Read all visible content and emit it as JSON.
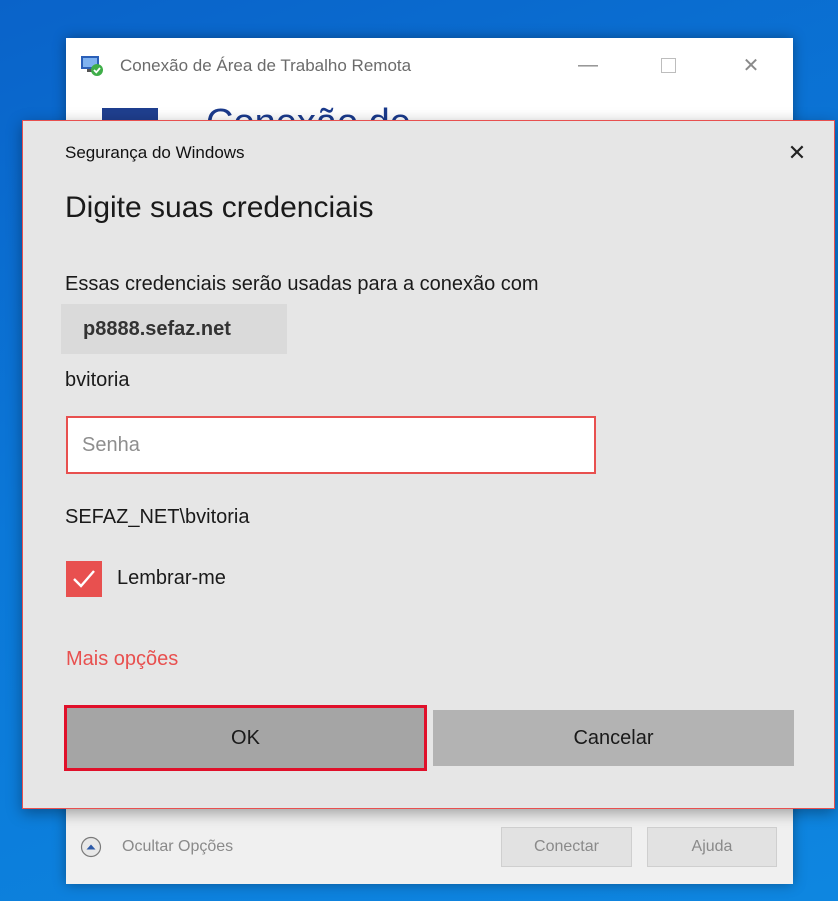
{
  "rdp_window": {
    "title": "Conexão de Área de Trabalho Remota",
    "header_text": "Conexão de",
    "toggle_label": "Ocultar Opções",
    "connect_label": "Conectar",
    "help_label": "Ajuda",
    "icons": {
      "app": "remote-desktop-icon",
      "minimize": "minimize-icon",
      "maximize": "maximize-icon",
      "close": "close-icon",
      "toggle": "chevron-up-circle-icon"
    }
  },
  "dialog": {
    "caption": "Segurança do Windows",
    "heading": "Digite suas credenciais",
    "description": "Essas credenciais serão usadas para a conexão com",
    "server": "p8888.sefaz.net",
    "username": "bvitoria",
    "password_placeholder": "Senha",
    "password_value": "",
    "domain_user": "SEFAZ_NET\\bvitoria",
    "remember_label": "Lembrar-me",
    "remember_checked": true,
    "more_options": "Mais opções",
    "ok_label": "OK",
    "cancel_label": "Cancelar",
    "icons": {
      "close": "close-icon",
      "check": "checkmark-icon"
    }
  },
  "colors": {
    "desktop": "#0b78d8",
    "accent": "#e8504f",
    "ok_highlight": "#e0102a",
    "dialog_bg": "#e6e6e6"
  }
}
